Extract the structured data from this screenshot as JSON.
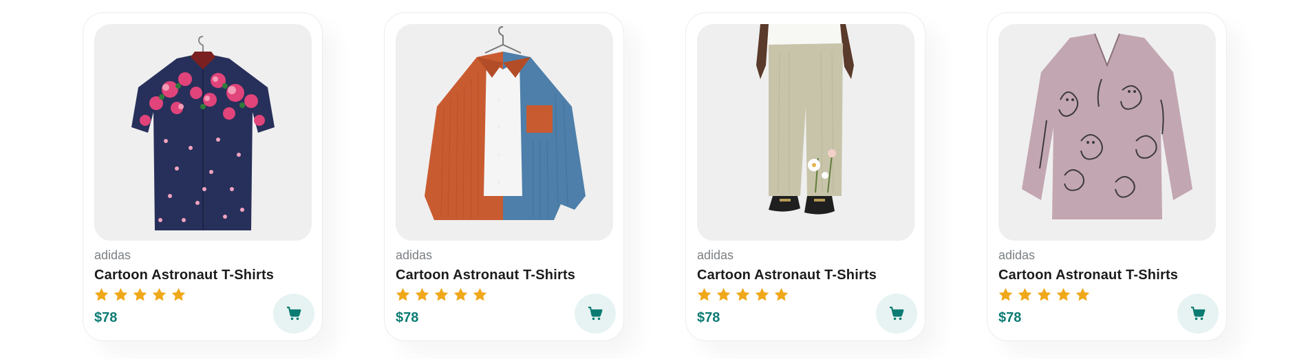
{
  "colors": {
    "accent": "#0b7b73",
    "star": "#f0a81b",
    "cart_bg": "#e6f3f2",
    "image_bg": "#efefef"
  },
  "products": [
    {
      "brand": "adidas",
      "title": "Cartoon Astronaut T-Shirts",
      "rating": 5,
      "price": "$78",
      "image": "navy-floral-short-sleeve-shirt"
    },
    {
      "brand": "adidas",
      "title": "Cartoon Astronaut T-Shirts",
      "rating": 5,
      "price": "$78",
      "image": "orange-blue-corduroy-shirt"
    },
    {
      "brand": "adidas",
      "title": "Cartoon Astronaut T-Shirts",
      "rating": 5,
      "price": "$78",
      "image": "linen-floral-pants"
    },
    {
      "brand": "adidas",
      "title": "Cartoon Astronaut T-Shirts",
      "rating": 5,
      "price": "$78",
      "image": "mauve-cat-print-blouse"
    }
  ]
}
